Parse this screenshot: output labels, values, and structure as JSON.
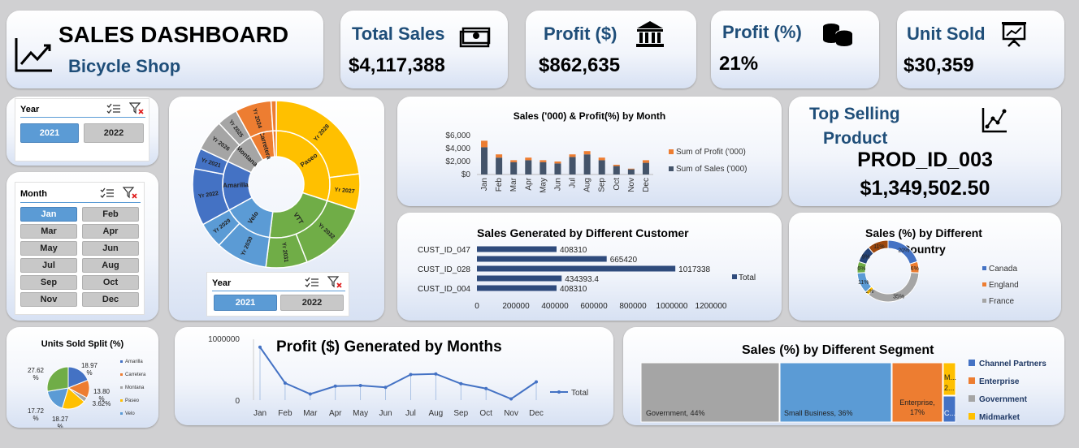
{
  "header": {
    "title": "SALES DASHBOARD",
    "subtitle": "Bicycle Shop"
  },
  "kpis": [
    {
      "title": "Total Sales",
      "value": "$4,117,388",
      "icon": "cash-icon"
    },
    {
      "title": "Profit  ($)",
      "value": "$862,635",
      "icon": "bank-icon"
    },
    {
      "title": "Profit  (%)",
      "value": "21%",
      "icon": "coins-icon"
    },
    {
      "title": "Unit Sold",
      "value": "$30,359",
      "icon": "presentation-icon"
    }
  ],
  "slicer_year": {
    "header": "Year",
    "options": [
      "2021",
      "2022"
    ],
    "selected": "2021"
  },
  "slicer_month": {
    "header": "Month",
    "options": [
      "Jan",
      "Feb",
      "Mar",
      "Apr",
      "May",
      "Jun",
      "Jul",
      "Aug",
      "Sep",
      "Oct",
      "Nov",
      "Dec"
    ],
    "selected": "Jan"
  },
  "slicer_year2": {
    "header": "Year",
    "options": [
      "2021",
      "2022"
    ],
    "selected": "2021"
  },
  "sunburst": {
    "inner": [
      {
        "label": "Paseo",
        "value": 30,
        "color": "#ffc000"
      },
      {
        "label": "VTT",
        "value": 22,
        "color": "#70ad47"
      },
      {
        "label": "Velo",
        "value": 15,
        "color": "#5b9bd5"
      },
      {
        "label": "Amarilla",
        "value": 15,
        "color": "#4472c4"
      },
      {
        "label": "Montana",
        "value": 10,
        "color": "#a5a5a5"
      },
      {
        "label": "Carretera",
        "value": 7,
        "color": "#ed7d31"
      },
      {
        "label": "",
        "value": 1,
        "color": "#ed7d31"
      }
    ],
    "outer": [
      {
        "label": "Yr 2028",
        "value": 23,
        "color": "#ffc000"
      },
      {
        "label": "Yr 2027",
        "value": 7,
        "color": "#ffc000"
      },
      {
        "label": "Yr 2032",
        "value": 14,
        "color": "#70ad47"
      },
      {
        "label": "Yr 2031",
        "value": 8,
        "color": "#70ad47"
      },
      {
        "label": "Yr 2030",
        "value": 10,
        "color": "#5b9bd5"
      },
      {
        "label": "Yr 2029",
        "value": 5,
        "color": "#5b9bd5"
      },
      {
        "label": "Yr 2022",
        "value": 11,
        "color": "#4472c4"
      },
      {
        "label": "Yr 2021",
        "value": 4,
        "color": "#4472c4"
      },
      {
        "label": "Yr 2026",
        "value": 6,
        "color": "#a5a5a5"
      },
      {
        "label": "Yr 2025",
        "value": 4,
        "color": "#a5a5a5"
      },
      {
        "label": "Yr 2024",
        "value": 7,
        "color": "#ed7d31"
      },
      {
        "label": "",
        "value": 1,
        "color": "#ed7d31"
      }
    ]
  },
  "top_product": {
    "title_line1": "Top Selling",
    "title_line2": "Product",
    "id": "PROD_ID_003",
    "value": "$1,349,502.50"
  },
  "chart_data": [
    {
      "id": "monthly",
      "type": "bar",
      "title": "Sales ('000) & Profit(%) by Month",
      "categories": [
        "Jan",
        "Feb",
        "Mar",
        "Apr",
        "May",
        "Jun",
        "Jul",
        "Aug",
        "Sep",
        "Oct",
        "Nov",
        "Dec"
      ],
      "series": [
        {
          "name": "Sum of Sales ('000)",
          "values": [
            4200,
            2600,
            1900,
            2200,
            1900,
            1700,
            2700,
            3100,
            2200,
            1300,
            800,
            1800
          ],
          "color": "#44546a"
        },
        {
          "name": "Sum of Profit ('000)",
          "values": [
            1000,
            500,
            300,
            400,
            300,
            300,
            400,
            500,
            400,
            200,
            100,
            400
          ],
          "color": "#ed7d31"
        }
      ],
      "ylim": [
        0,
        6000
      ],
      "yticks": [
        "$0",
        "$2,000",
        "$4,000",
        "$6,000"
      ]
    },
    {
      "id": "customers",
      "type": "bar",
      "orientation": "horizontal",
      "title": "Sales Generated by Different Customer",
      "categories": [
        "CUST_ID_047",
        "",
        "CUST_ID_028",
        "",
        "CUST_ID_004"
      ],
      "values": [
        408310,
        665420,
        1017338,
        434393.4,
        408310
      ],
      "labels": [
        "408310",
        "665420",
        "1017338",
        "434393.4",
        "408310"
      ],
      "xticks": [
        "0",
        "200000",
        "400000",
        "600000",
        "800000",
        "1000000",
        "1200000"
      ],
      "xlim": [
        0,
        1200000
      ],
      "legend": "Total",
      "color": "#2f4b7c"
    },
    {
      "id": "country",
      "type": "pie",
      "title": "Sales (%) by Different Country",
      "labels": [
        "Canada",
        "England",
        "France"
      ],
      "slices": [
        {
          "value": 20,
          "color": "#4472c4"
        },
        {
          "value": 6,
          "color": "#ed7d31"
        },
        {
          "value": 35,
          "color": "#a5a5a5"
        },
        {
          "value": 2,
          "color": "#ffc000"
        },
        {
          "value": 11,
          "color": "#5b9bd5"
        },
        {
          "value": 6,
          "color": "#70ad47"
        },
        {
          "value": 9,
          "color": "#264478"
        },
        {
          "value": 11,
          "color": "#9e480e"
        }
      ],
      "slice_labels": [
        "20%",
        "6%",
        "35%",
        "2%",
        "11%",
        "6%",
        "9%",
        "11%"
      ],
      "legend_colors": [
        "#4472c4",
        "#ed7d31",
        "#a5a5a5"
      ]
    },
    {
      "id": "units",
      "type": "pie",
      "title": "Units Sold Split (%)",
      "labels": [
        "Amarilla",
        "Carretera",
        "Montana",
        "Paseo",
        "Velo"
      ],
      "values": [
        18.97,
        13.8,
        3.62,
        18.27,
        17.72,
        27.62
      ],
      "slice_labels": [
        "18.97 %",
        "13.80 %",
        "3.62%",
        "18.27 %",
        "17.72 %",
        "27.62 %"
      ],
      "colors": [
        "#4472c4",
        "#ed7d31",
        "#a5a5a5",
        "#ffc000",
        "#5b9bd5",
        "#70ad47"
      ]
    },
    {
      "id": "profit",
      "type": "line",
      "title": "Profit ($) Generated by Months",
      "categories": [
        "Jan",
        "Feb",
        "Mar",
        "Apr",
        "May",
        "Jun",
        "Jul",
        "Aug",
        "Sep",
        "Oct",
        "Nov",
        "Dec"
      ],
      "values": [
        870000,
        280000,
        100000,
        230000,
        240000,
        210000,
        420000,
        430000,
        270000,
        190000,
        20000,
        300000
      ],
      "yticks": [
        "0",
        "1000000"
      ],
      "ylim": [
        0,
        1000000
      ],
      "legend": "Total",
      "color": "#4472c4"
    },
    {
      "id": "segment",
      "type": "treemap",
      "title": "Sales (%) by Different Segment",
      "items": [
        {
          "label": "Government, 44%",
          "value": 44,
          "color": "#a5a5a5"
        },
        {
          "label": "Small Business, 36%",
          "value": 36,
          "color": "#5b9bd5"
        },
        {
          "label": "Enterprise, 17%",
          "value": 17,
          "color": "#ed7d31"
        },
        {
          "label": "M... 2...",
          "value": 2,
          "color": "#ffc000"
        },
        {
          "label": "C...",
          "value": 1,
          "color": "#4472c4"
        }
      ],
      "legend": [
        {
          "name": "Channel Partners",
          "color": "#4472c4"
        },
        {
          "name": "Enterprise",
          "color": "#ed7d31"
        },
        {
          "name": "Government",
          "color": "#a5a5a5"
        },
        {
          "name": "Midmarket",
          "color": "#ffc000"
        }
      ]
    }
  ]
}
